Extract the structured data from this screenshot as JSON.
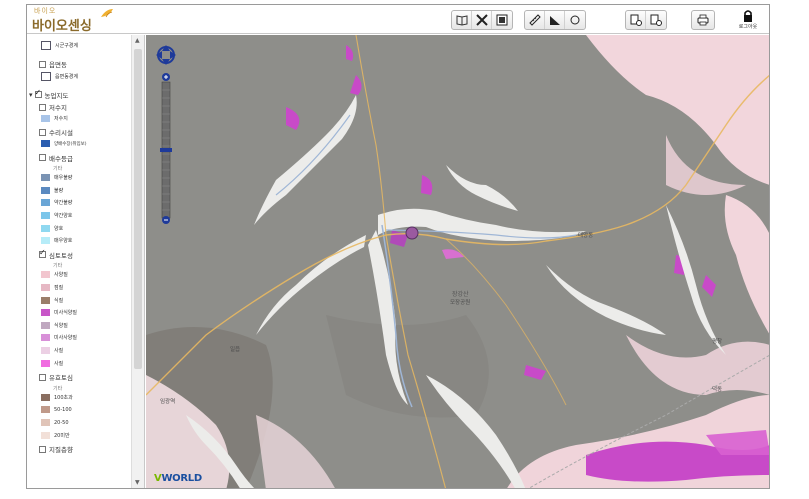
{
  "header": {
    "logo_top": "바이오",
    "logo_main": "바이오센싱",
    "logout_caption": "로그아웃",
    "toolbar": [
      {
        "name": "map-view-button",
        "icon": "book-icon"
      },
      {
        "name": "tools-button",
        "icon": "cross-tools-icon"
      },
      {
        "name": "layers-button",
        "icon": "layers-icon"
      },
      {
        "name": "measure-distance-button",
        "icon": "ruler-icon"
      },
      {
        "name": "measure-area-button",
        "icon": "triangle-icon"
      },
      {
        "name": "measure-radius-button",
        "icon": "circle-icon"
      },
      {
        "name": "print-setup-button",
        "icon": "doc-gear-icon"
      },
      {
        "name": "print-preview-button",
        "icon": "doc-gear-icon"
      },
      {
        "name": "print-button",
        "icon": "printer-icon"
      }
    ]
  },
  "sidebar": {
    "items": [
      {
        "label": "시군구경계",
        "kind": "legend",
        "checked": false
      },
      {
        "label": "읍면동",
        "kind": "checkbox",
        "checked": false
      },
      {
        "label": "읍면동경계",
        "kind": "legend"
      },
      {
        "label": "농업지도",
        "kind": "group",
        "checked": true
      },
      {
        "label": "저수지",
        "kind": "checkbox",
        "checked": false
      },
      {
        "label": "저수지",
        "kind": "legend",
        "color": "#a8c4e8"
      },
      {
        "label": "수리시설",
        "kind": "checkbox",
        "checked": false
      },
      {
        "label": "양배수장(취입보)",
        "kind": "legend",
        "color": "#2a5db0"
      },
      {
        "label": "배수등급",
        "kind": "checkbox",
        "checked": false
      },
      {
        "label": "기타",
        "kind": "caption"
      },
      {
        "label": "매우불량",
        "kind": "legend",
        "color": "#7a93b3"
      },
      {
        "label": "불량",
        "kind": "legend",
        "color": "#5b8ac0"
      },
      {
        "label": "약간불량",
        "kind": "legend",
        "color": "#6aa6d6"
      },
      {
        "label": "약간양호",
        "kind": "legend",
        "color": "#7cc6ea"
      },
      {
        "label": "양호",
        "kind": "legend",
        "color": "#8fd8f0"
      },
      {
        "label": "매우양호",
        "kind": "legend",
        "color": "#b6ecf8"
      },
      {
        "label": "심토토성",
        "kind": "checkbox",
        "checked": true
      },
      {
        "label": "기타",
        "kind": "caption"
      },
      {
        "label": "사양질",
        "kind": "legend",
        "color": "#f2c6cf"
      },
      {
        "label": "점질",
        "kind": "legend",
        "color": "#e6b8c4"
      },
      {
        "label": "식질",
        "kind": "legend",
        "color": "#9a7e6a"
      },
      {
        "label": "미사식양질",
        "kind": "legend",
        "color": "#c856c8"
      },
      {
        "label": "식양질",
        "kind": "legend",
        "color": "#c0a8c0"
      },
      {
        "label": "미사사양질",
        "kind": "legend",
        "color": "#d890d8"
      },
      {
        "label": "사질",
        "kind": "legend",
        "color": "#ecd0e4"
      },
      {
        "label": "사질",
        "kind": "legend",
        "color": "#f06ce0"
      },
      {
        "label": "유효토심",
        "kind": "checkbox",
        "checked": false
      },
      {
        "label": "기타",
        "kind": "caption"
      },
      {
        "label": "100초과",
        "kind": "legend",
        "color": "#8a6e60"
      },
      {
        "label": "50-100",
        "kind": "legend",
        "color": "#c09a8a"
      },
      {
        "label": "20-50",
        "kind": "legend",
        "color": "#e0c4b8"
      },
      {
        "label": "20미만",
        "kind": "legend",
        "color": "#f2e0d8"
      },
      {
        "label": "지질층향",
        "kind": "checkbox",
        "checked": false
      }
    ]
  },
  "map": {
    "labels": [
      "대양동",
      "장강산",
      "모장공원",
      "일읍",
      "임광역",
      "평창",
      "덕동"
    ],
    "attribution_v": "V",
    "attribution_rest": "WORLD"
  },
  "colors": {
    "map_base": "#8c8c88",
    "pink_area": "#f2d6dc",
    "magenta": "#c84ac8",
    "river": "#9fb6d6",
    "road": "#e8b860"
  }
}
